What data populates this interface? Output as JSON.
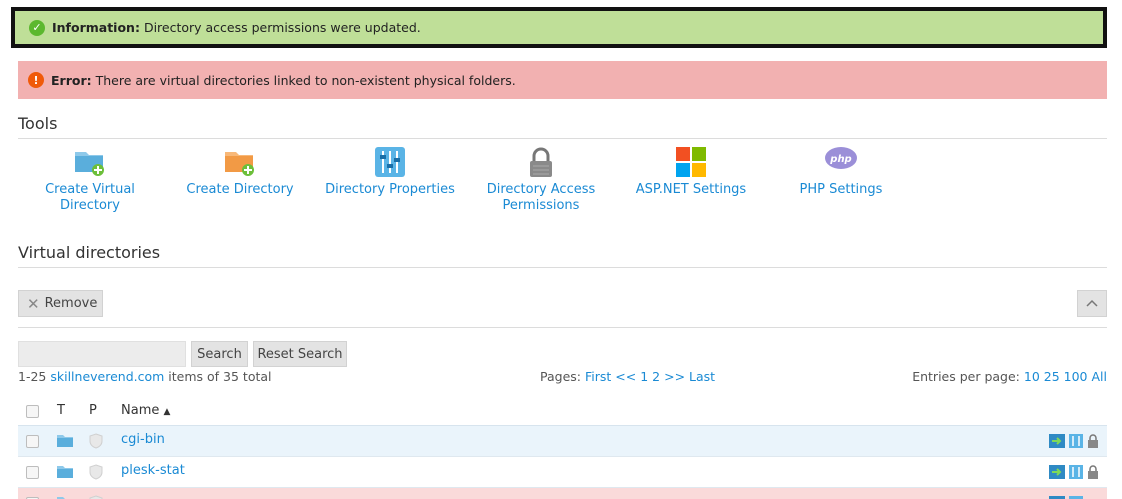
{
  "messages": {
    "info": {
      "label": "Information:",
      "text": "Directory access permissions were updated."
    },
    "error": {
      "label": "Error:",
      "text": "There are virtual directories linked to non-existent physical folders."
    }
  },
  "tools": {
    "title": "Tools",
    "items": [
      {
        "label": "Create Virtual Directory",
        "icon": "folder-add-icon"
      },
      {
        "label": "Create Directory",
        "icon": "folder-add-orange-icon"
      },
      {
        "label": "Directory Properties",
        "icon": "sliders-icon"
      },
      {
        "label": "Directory Access Permissions",
        "icon": "lock-icon"
      },
      {
        "label": "ASP.NET Settings",
        "icon": "windows-logo-icon"
      },
      {
        "label": "PHP Settings",
        "icon": "php-logo-icon"
      }
    ]
  },
  "virtual_dirs": {
    "title": "Virtual directories",
    "remove_label": "Remove",
    "search_label": "Search",
    "reset_search_label": "Reset Search",
    "search_placeholder": "",
    "range": "1-25",
    "domain": "skillneverend.com",
    "items_total": "items of 35 total",
    "pages_label": "Pages:",
    "pages": [
      "First",
      "<<",
      "1",
      "2",
      ">>",
      "Last"
    ],
    "entries_label": "Entries per page:",
    "entries": [
      "10",
      "25",
      "100",
      "All"
    ],
    "columns": {
      "t": "T",
      "p": "P",
      "name": "Name"
    },
    "rows": [
      {
        "name": "cgi-bin",
        "state": "selected"
      },
      {
        "name": "plesk-stat",
        "state": "normal"
      },
      {
        "name": "",
        "state": "error"
      }
    ]
  },
  "colors": {
    "info_bg": "#bfdf98",
    "error_bg": "#f2b1b1",
    "link": "#1a8ad4"
  }
}
